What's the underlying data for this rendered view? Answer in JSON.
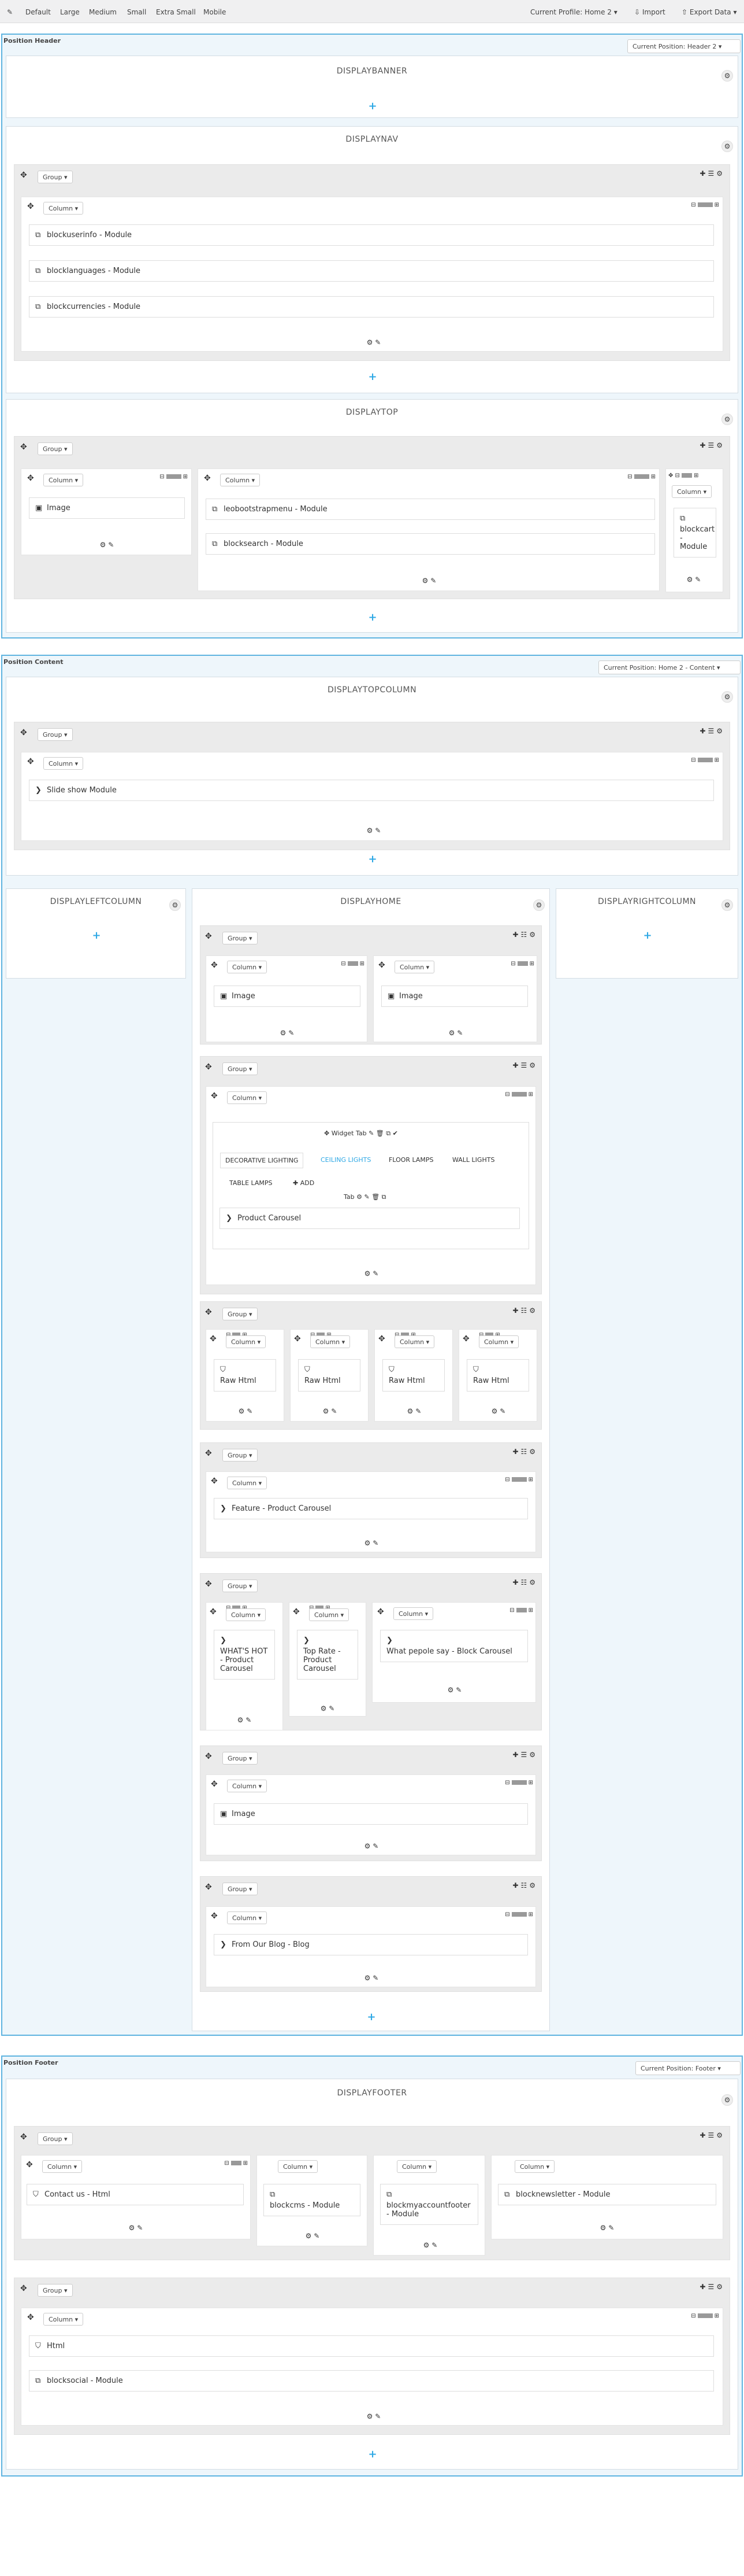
{
  "toolbar": {
    "items": [
      "Default",
      "Large",
      "Medium",
      "Small",
      "Extra Small",
      "Mobile"
    ],
    "profile": "Current Profile: Home 2 ▾",
    "import": "Import",
    "export": "Export Data ▾"
  },
  "common": {
    "group": "Group ▾",
    "column": "Column ▾",
    "add": "+",
    "gear": "⚙",
    "edit": "⚙ ✎"
  },
  "header": {
    "title": "Position Header",
    "select": "Current Position: Header 2 ▾",
    "banner": "DISPLAYBANNER",
    "nav": "DISPLAYNAV",
    "nav_modules": [
      "blockuserinfo - Module",
      "blocklanguages - Module",
      "blockcurrencies - Module"
    ],
    "top": "DISPLAYTOP",
    "top_image": "Image",
    "top_modules": [
      "leobootstrapmenu - Module",
      "blocksearch - Module"
    ],
    "top_cart": "blockcart - Module"
  },
  "content": {
    "title": "Position Content",
    "select": "Current Position: Home 2 - Content ▾",
    "topcolumn": "DISPLAYTOPCOLUMN",
    "slideshow": "Slide show Module",
    "left": "DISPLAYLEFTCOLUMN",
    "home": "DISPLAYHOME",
    "right": "DISPLAYRIGHTCOLUMN",
    "image": "Image",
    "widget_tab": "Widget Tab",
    "tabs": [
      "DECORATIVE LIGHTING",
      "CEILING LIGHTS",
      "FLOOR LAMPS",
      "WALL LIGHTS",
      "TABLE LAMPS"
    ],
    "add_tab": "ADD",
    "tab_label": "Tab",
    "product_carousel": "Product Carousel",
    "raw_html": "Raw Html",
    "feature": "Feature - Product Carousel",
    "whats_hot": "WHAT'S HOT - Product Carousel",
    "top_rate": "Top Rate - Product Carousel",
    "what_people": "What pepole say - Block Carousel",
    "blog": "From Our Blog - Blog"
  },
  "footer": {
    "title": "Position Footer",
    "select": "Current Position: Footer ▾",
    "hook": "DISPLAYFOOTER",
    "contact": "Contact us - Html",
    "blockcms": "blockcms - Module",
    "myaccount": "blockmyaccountfooter - Module",
    "newsletter": "blocknewsletter - Module",
    "html": "Html",
    "social": "blocksocial - Module"
  }
}
